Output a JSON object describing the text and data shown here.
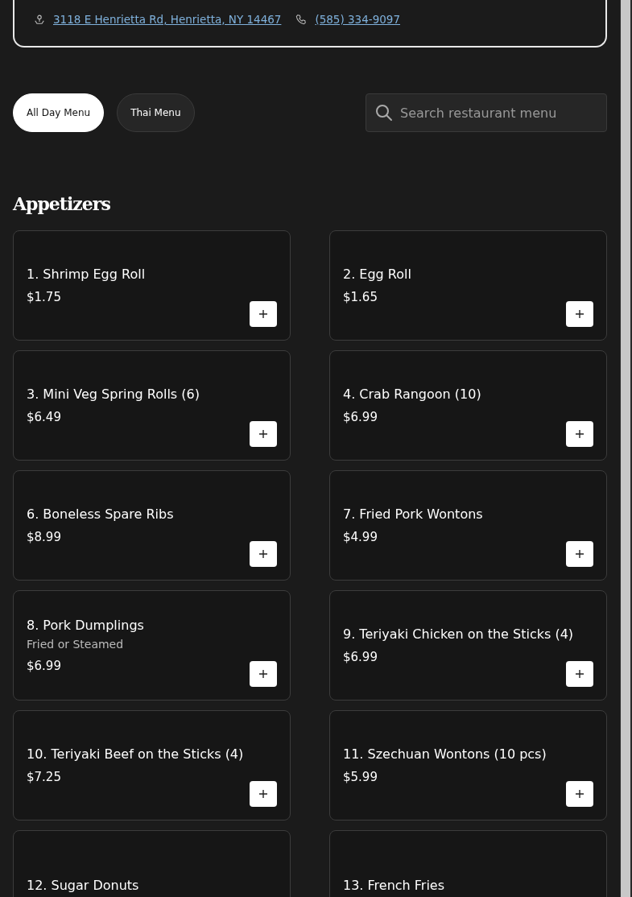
{
  "location": {
    "address": "3118 E Henrietta Rd, Henrietta, NY 14467",
    "phone": "(585) 334-9097"
  },
  "tabs": [
    {
      "label": "All Day Menu",
      "selected": true
    },
    {
      "label": "Thai Menu",
      "selected": false
    }
  ],
  "search": {
    "placeholder": "Search restaurant menu"
  },
  "section": {
    "title": "Appetizers"
  },
  "items": [
    {
      "name": "1. Shrimp Egg Roll",
      "price": "$1.75"
    },
    {
      "name": "2. Egg Roll",
      "price": "$1.65"
    },
    {
      "name": "3. Mini Veg Spring Rolls (6)",
      "price": "$6.49"
    },
    {
      "name": "4. Crab Rangoon (10)",
      "price": "$6.99"
    },
    {
      "name": "6. Boneless Spare Ribs",
      "price": "$8.99"
    },
    {
      "name": "7. Fried Pork Wontons",
      "price": "$4.99"
    },
    {
      "name": "8. Pork Dumplings",
      "description": "Fried or Steamed",
      "price": "$6.99"
    },
    {
      "name": "9. Teriyaki Chicken on the Sticks (4)",
      "price": "$6.99"
    },
    {
      "name": "10. Teriyaki Beef on the Sticks (4)",
      "price": "$7.25"
    },
    {
      "name": "11. Szechuan Wontons (10 pcs)",
      "price": "$5.99"
    },
    {
      "name": "12. Sugar Donuts"
    },
    {
      "name": "13. French Fries"
    }
  ]
}
